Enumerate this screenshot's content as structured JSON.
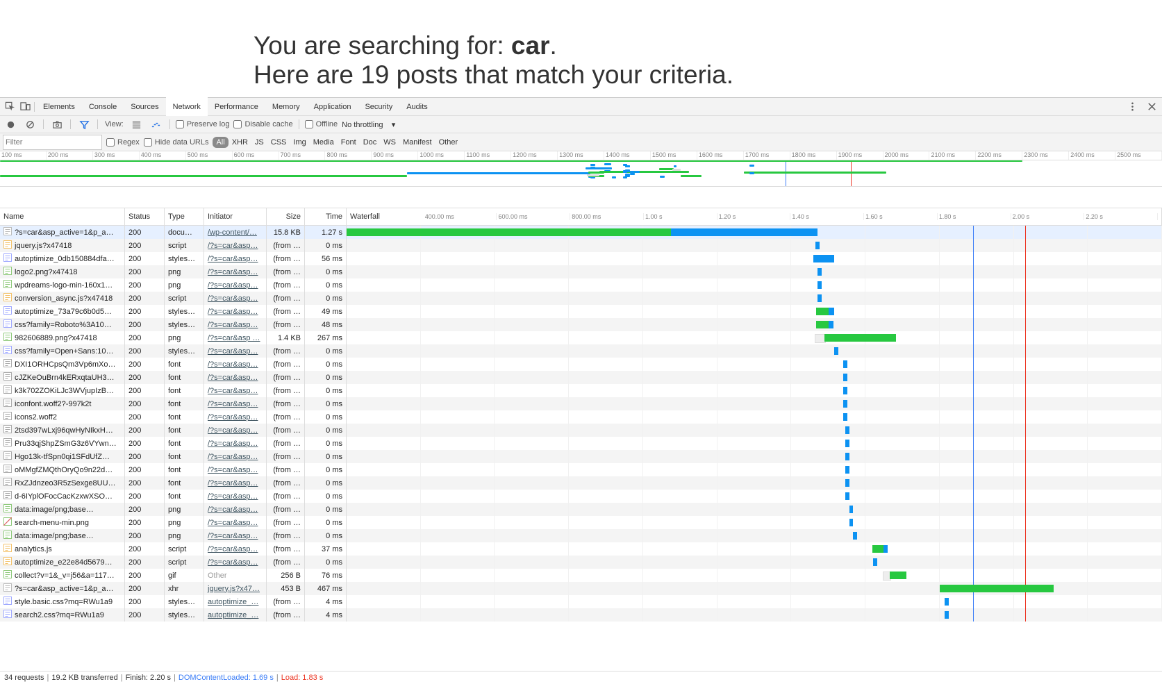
{
  "page": {
    "line1_before": "You are searching for: ",
    "line1_bold": "car",
    "line1_after": ".",
    "line2": "Here are 19 posts that match your criteria."
  },
  "tabs": [
    "Elements",
    "Console",
    "Sources",
    "Network",
    "Performance",
    "Memory",
    "Application",
    "Security",
    "Audits"
  ],
  "toolbar": {
    "view_label": "View:",
    "preserve": "Preserve log",
    "disable": "Disable cache",
    "offline": "Offline",
    "throttling": "No throttling"
  },
  "filterbar": {
    "filter_placeholder": "Filter",
    "regex": "Regex",
    "hide": "Hide data URLs",
    "chips": [
      "All",
      "XHR",
      "JS",
      "CSS",
      "Img",
      "Media",
      "Font",
      "Doc",
      "WS",
      "Manifest",
      "Other"
    ]
  },
  "overview_ticks": [
    "100 ms",
    "200 ms",
    "300 ms",
    "400 ms",
    "500 ms",
    "600 ms",
    "700 ms",
    "800 ms",
    "900 ms",
    "1000 ms",
    "1100 ms",
    "1200 ms",
    "1300 ms",
    "1400 ms",
    "1500 ms",
    "1600 ms",
    "1700 ms",
    "1800 ms",
    "1900 ms",
    "2000 ms",
    "2100 ms",
    "2200 ms",
    "2300 ms",
    "2400 ms",
    "2500 ms"
  ],
  "columns": [
    "Name",
    "Status",
    "Type",
    "Initiator",
    "Size",
    "Time",
    "Waterfall"
  ],
  "wf_ticks": [
    "",
    "400.00 ms",
    "600.00 ms",
    "800.00 ms",
    "1.00 s",
    "1.20 s",
    "1.40 s",
    "1.60 s",
    "1.80 s",
    "2.00 s",
    "2.20 s"
  ],
  "wf_max_ms": 2200,
  "markers": {
    "dom_ms": 1690,
    "load_ms": 1830
  },
  "rows": [
    {
      "name": "?s=car&asp_active=1&p_a…",
      "status": "200",
      "type": "docu…",
      "init": "/wp-content/…",
      "itype": "link",
      "size": "15.8 KB",
      "time": "1.27 s",
      "sel": true,
      "icon": "doc",
      "bars": [
        [
          "wait",
          0,
          876
        ],
        [
          "content",
          876,
          1270
        ]
      ]
    },
    {
      "name": "jquery.js?x47418",
      "status": "200",
      "type": "script",
      "init": "/?s=car&asp…",
      "itype": "link",
      "size": "(from …",
      "time": "0 ms",
      "icon": "js",
      "bars": [
        [
          "content",
          1265,
          1275
        ]
      ]
    },
    {
      "name": "autoptimize_0db150884dfa…",
      "status": "200",
      "type": "styles…",
      "init": "/?s=car&asp…",
      "itype": "link",
      "size": "(from …",
      "time": "56 ms",
      "icon": "css",
      "bars": [
        [
          "content",
          1260,
          1316
        ]
      ]
    },
    {
      "name": "logo2.png?x47418",
      "status": "200",
      "type": "png",
      "init": "/?s=car&asp…",
      "itype": "link",
      "size": "(from …",
      "time": "0 ms",
      "icon": "img",
      "bars": [
        [
          "content",
          1270,
          1280
        ]
      ]
    },
    {
      "name": "wpdreams-logo-min-160x1…",
      "status": "200",
      "type": "png",
      "init": "/?s=car&asp…",
      "itype": "link",
      "size": "(from …",
      "time": "0 ms",
      "icon": "img",
      "bars": [
        [
          "content",
          1270,
          1280
        ]
      ]
    },
    {
      "name": "conversion_async.js?x47418",
      "status": "200",
      "type": "script",
      "init": "/?s=car&asp…",
      "itype": "link",
      "size": "(from …",
      "time": "0 ms",
      "icon": "js",
      "bars": [
        [
          "content",
          1270,
          1280
        ]
      ]
    },
    {
      "name": "autoptimize_73a79c6b0d5…",
      "status": "200",
      "type": "styles…",
      "init": "/?s=car&asp…",
      "itype": "link",
      "size": "(from …",
      "time": "49 ms",
      "icon": "css",
      "bars": [
        [
          "wait",
          1266,
          1300
        ],
        [
          "content",
          1300,
          1315
        ]
      ]
    },
    {
      "name": "css?family=Roboto%3A10…",
      "status": "200",
      "type": "styles…",
      "init": "/?s=car&asp…",
      "itype": "link",
      "size": "(from …",
      "time": "48 ms",
      "icon": "css",
      "bars": [
        [
          "wait",
          1266,
          1300
        ],
        [
          "content",
          1300,
          1314
        ]
      ]
    },
    {
      "name": "982606889.png?x47418",
      "status": "200",
      "type": "png",
      "init": "/?s=car&asp …",
      "itype": "link",
      "size": "1.4 KB",
      "time": "267 ms",
      "icon": "img",
      "bars": [
        [
          "connect",
          1263,
          1290
        ],
        [
          "wait",
          1290,
          1483
        ]
      ]
    },
    {
      "name": "css?family=Open+Sans:10…",
      "status": "200",
      "type": "styles…",
      "init": "/?s=car&asp…",
      "itype": "link",
      "size": "(from …",
      "time": "0 ms",
      "icon": "css",
      "bars": [
        [
          "content",
          1316,
          1326
        ]
      ]
    },
    {
      "name": "DXI1ORHCpsQm3Vp6mXo…",
      "status": "200",
      "type": "font",
      "init": "/?s=car&asp…",
      "itype": "link",
      "size": "(from …",
      "time": "0 ms",
      "icon": "font",
      "bars": [
        [
          "content",
          1340,
          1350
        ]
      ]
    },
    {
      "name": "cJZKeOuBrn4kERxqtaUH3…",
      "status": "200",
      "type": "font",
      "init": "/?s=car&asp…",
      "itype": "link",
      "size": "(from …",
      "time": "0 ms",
      "icon": "font",
      "bars": [
        [
          "content",
          1340,
          1350
        ]
      ]
    },
    {
      "name": "k3k702ZOKiLJc3WVjupIzB…",
      "status": "200",
      "type": "font",
      "init": "/?s=car&asp…",
      "itype": "link",
      "size": "(from …",
      "time": "0 ms",
      "icon": "font",
      "bars": [
        [
          "content",
          1340,
          1350
        ]
      ]
    },
    {
      "name": "iconfont.woff2?-997k2t",
      "status": "200",
      "type": "font",
      "init": "/?s=car&asp…",
      "itype": "link",
      "size": "(from …",
      "time": "0 ms",
      "icon": "font",
      "bars": [
        [
          "content",
          1340,
          1350
        ]
      ]
    },
    {
      "name": "icons2.woff2",
      "status": "200",
      "type": "font",
      "init": "/?s=car&asp…",
      "itype": "link",
      "size": "(from …",
      "time": "0 ms",
      "icon": "font",
      "bars": [
        [
          "content",
          1340,
          1350
        ]
      ]
    },
    {
      "name": "2tsd397wLxj96qwHyNIkxH…",
      "status": "200",
      "type": "font",
      "init": "/?s=car&asp…",
      "itype": "link",
      "size": "(from …",
      "time": "0 ms",
      "icon": "font",
      "bars": [
        [
          "content",
          1345,
          1355
        ]
      ]
    },
    {
      "name": "Pru33qjShpZSmG3z6VYwn…",
      "status": "200",
      "type": "font",
      "init": "/?s=car&asp…",
      "itype": "link",
      "size": "(from …",
      "time": "0 ms",
      "icon": "font",
      "bars": [
        [
          "content",
          1345,
          1355
        ]
      ]
    },
    {
      "name": "Hgo13k-tfSpn0qi1SFdUfZ…",
      "status": "200",
      "type": "font",
      "init": "/?s=car&asp…",
      "itype": "link",
      "size": "(from …",
      "time": "0 ms",
      "icon": "font",
      "bars": [
        [
          "content",
          1345,
          1355
        ]
      ]
    },
    {
      "name": "oMMgfZMQthOryQo9n22d…",
      "status": "200",
      "type": "font",
      "init": "/?s=car&asp…",
      "itype": "link",
      "size": "(from …",
      "time": "0 ms",
      "icon": "font",
      "bars": [
        [
          "content",
          1345,
          1355
        ]
      ]
    },
    {
      "name": "RxZJdnzeo3R5zSexge8UU…",
      "status": "200",
      "type": "font",
      "init": "/?s=car&asp…",
      "itype": "link",
      "size": "(from …",
      "time": "0 ms",
      "icon": "font",
      "bars": [
        [
          "content",
          1345,
          1355
        ]
      ]
    },
    {
      "name": "d-6IYplOFocCacKzxwXSO…",
      "status": "200",
      "type": "font",
      "init": "/?s=car&asp…",
      "itype": "link",
      "size": "(from …",
      "time": "0 ms",
      "icon": "font",
      "bars": [
        [
          "content",
          1345,
          1355
        ]
      ]
    },
    {
      "name": "data:image/png;base…",
      "status": "200",
      "type": "png",
      "init": "/?s=car&asp…",
      "itype": "link",
      "size": "(from …",
      "time": "0 ms",
      "icon": "img",
      "bars": [
        [
          "content",
          1356,
          1366
        ]
      ]
    },
    {
      "name": "search-menu-min.png",
      "status": "200",
      "type": "png",
      "init": "/?s=car&asp…",
      "itype": "link",
      "size": "(from …",
      "time": "0 ms",
      "icon": "imgslash",
      "bars": [
        [
          "content",
          1356,
          1366
        ]
      ]
    },
    {
      "name": "data:image/png;base…",
      "status": "200",
      "type": "png",
      "init": "/?s=car&asp…",
      "itype": "link",
      "size": "(from …",
      "time": "0 ms",
      "icon": "img",
      "bars": [
        [
          "content",
          1366,
          1376
        ]
      ]
    },
    {
      "name": "analytics.js",
      "status": "200",
      "type": "script",
      "init": "/?s=car&asp…",
      "itype": "link",
      "size": "(from …",
      "time": "37 ms",
      "icon": "js",
      "bars": [
        [
          "wait",
          1418,
          1449
        ],
        [
          "content",
          1449,
          1455
        ]
      ]
    },
    {
      "name": "autoptimize_e22e84d5679…",
      "status": "200",
      "type": "script",
      "init": "/?s=car&asp…",
      "itype": "link",
      "size": "(from …",
      "time": "0 ms",
      "icon": "js",
      "bars": [
        [
          "content",
          1420,
          1430
        ]
      ]
    },
    {
      "name": "collect?v=1&_v=j56&a=117…",
      "status": "200",
      "type": "gif",
      "init": "Other",
      "itype": "other",
      "size": "256 B",
      "time": "76 ms",
      "icon": "img",
      "bars": [
        [
          "connect",
          1447,
          1465
        ],
        [
          "wait",
          1465,
          1510
        ]
      ]
    },
    {
      "name": "?s=car&asp_active=1&p_a…",
      "status": "200",
      "type": "xhr",
      "init": "jquery.js?x47…",
      "itype": "link",
      "size": "453 B",
      "time": "467 ms",
      "icon": "doc",
      "bars": [
        [
          "wait",
          1600,
          1907
        ]
      ]
    },
    {
      "name": "style.basic.css?mq=RWu1a9",
      "status": "200",
      "type": "styles…",
      "init": "autoptimize_…",
      "itype": "link",
      "size": "(from …",
      "time": "4 ms",
      "icon": "css",
      "bars": [
        [
          "content",
          1613,
          1623
        ]
      ]
    },
    {
      "name": "search2.css?mq=RWu1a9",
      "status": "200",
      "type": "styles…",
      "init": "autoptimize_…",
      "itype": "link",
      "size": "(from …",
      "time": "4 ms",
      "icon": "css",
      "bars": [
        [
          "content",
          1613,
          1623
        ]
      ]
    }
  ],
  "status": {
    "requests": "34 requests",
    "transferred": "19.2 KB transferred",
    "finish": "Finish: 2.20 s",
    "dom": "DOMContentLoaded: 1.69 s",
    "load": "Load: 1.83 s"
  }
}
